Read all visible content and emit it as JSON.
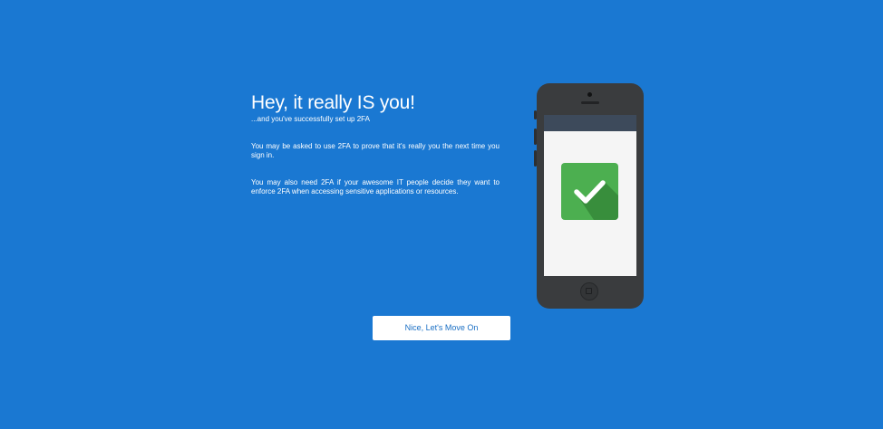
{
  "content": {
    "title": "Hey, it really IS you!",
    "subtitle": "...and you've successfully set up 2FA",
    "paragraph_1": "You may be asked to use 2FA to prove that it's really you the next time you sign in.",
    "paragraph_2": "You may also need 2FA if your awesome IT people decide they want to enforce 2FA when accessing sensitive applications or resources."
  },
  "actions": {
    "continue_label": "Nice, Let's Move On"
  },
  "illustration": {
    "device": "phone-icon",
    "status_icon": "checkmark-icon",
    "colors": {
      "background": "#1a78d2",
      "phone_body": "#3a3c3e",
      "screen": "#f5f5f5",
      "screen_header": "#3d4a5b",
      "check_tile": "#4caf50",
      "check_shadow": "#388e3c"
    }
  },
  "colors": {
    "button_text": "#1a6fc4",
    "button_background": "#ffffff"
  }
}
